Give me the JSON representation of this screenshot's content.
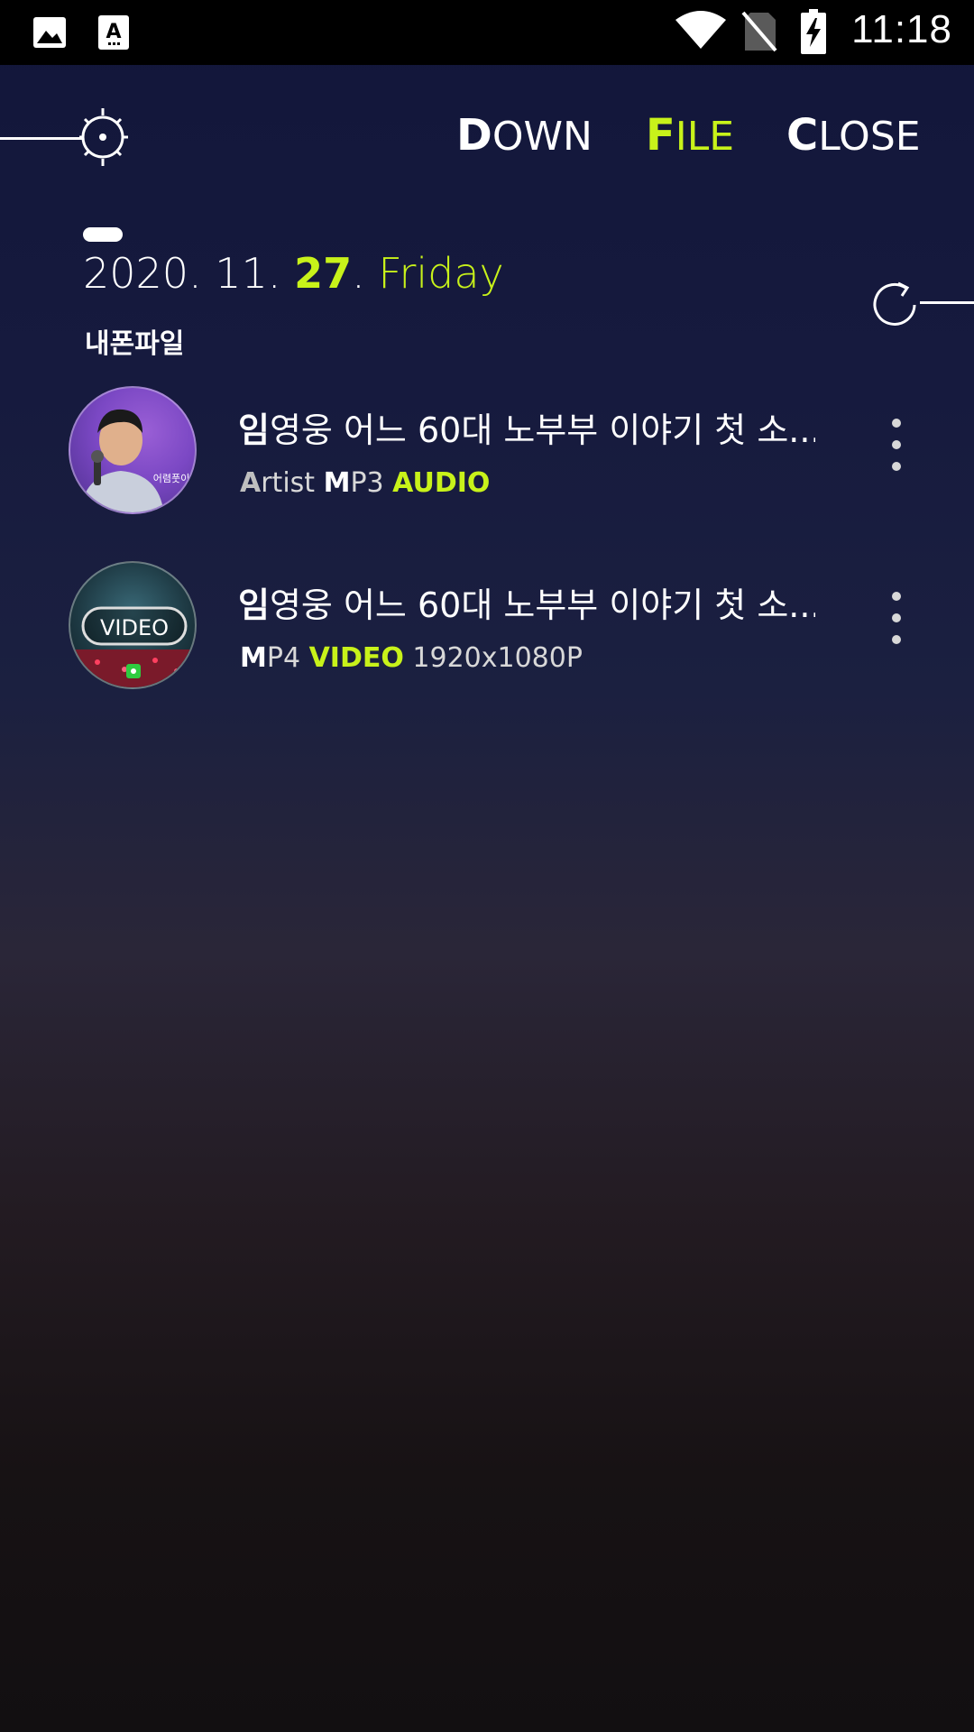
{
  "status_bar": {
    "time": "11:18",
    "icons": [
      "image-icon",
      "a-font-icon",
      "wifi-icon",
      "no-sim-icon",
      "battery-charging-icon"
    ]
  },
  "header": {
    "nav": [
      {
        "initial": "D",
        "rest": "OWN"
      },
      {
        "initial": "F",
        "rest": "ILE"
      },
      {
        "initial": "C",
        "rest": "LOSE"
      }
    ],
    "active_tab": "FILE"
  },
  "date": {
    "prefix": "2020. 11. ",
    "day": "27",
    "sep": ". ",
    "weekday": "Friday"
  },
  "section_label": "내폰파일",
  "files": [
    {
      "title_initial": "임",
      "title_rest": "영웅 어느 60대 노부부 이야기 첫 소...",
      "meta": [
        {
          "text": "A",
          "style": "b-gray"
        },
        {
          "text": "rtist ",
          "style": "plain"
        },
        {
          "text": "M",
          "style": "b"
        },
        {
          "text": "P3 ",
          "style": "plain"
        },
        {
          "text": "AUDIO",
          "style": "g"
        }
      ],
      "thumb_caption": "어렴풋이"
    },
    {
      "title_initial": "임",
      "title_rest": "영웅 어느 60대 노부부 이야기 첫 소...",
      "meta": [
        {
          "text": "M",
          "style": "b"
        },
        {
          "text": "P4 ",
          "style": "plain"
        },
        {
          "text": "VIDEO",
          "style": "g"
        },
        {
          "text": " 1920x1080P",
          "style": "plain"
        }
      ],
      "thumb_caption": "VIDEO"
    }
  ],
  "colors": {
    "accent": "#c8f21a",
    "background_top": "#12163a",
    "background_bottom": "#120f11"
  }
}
